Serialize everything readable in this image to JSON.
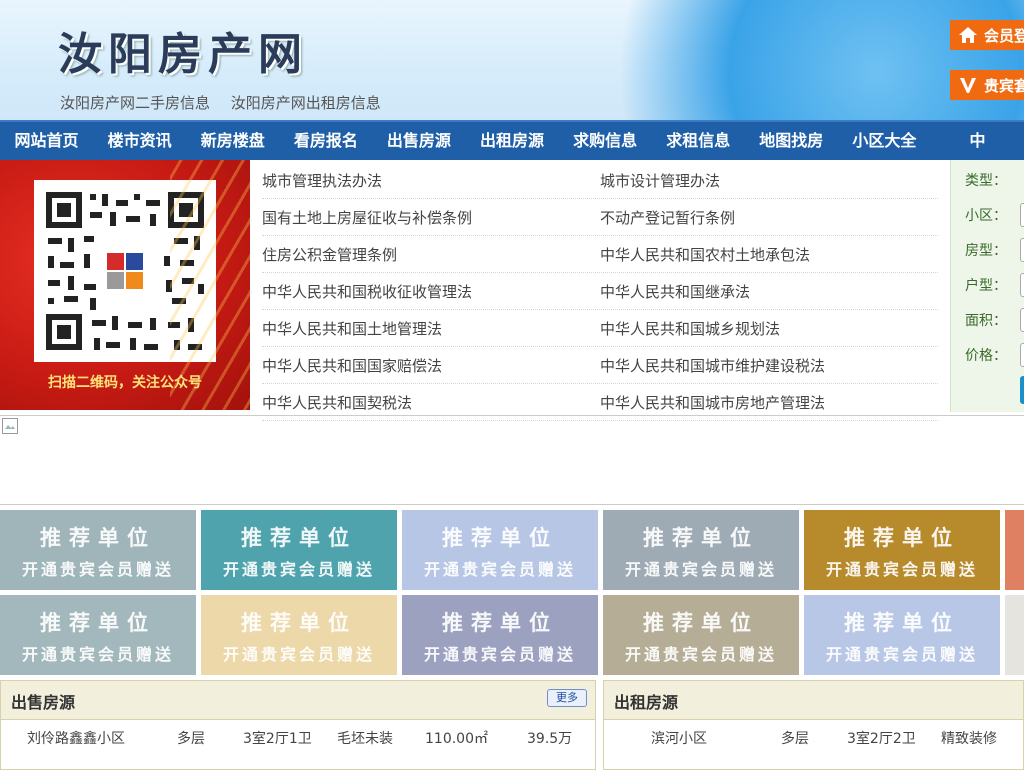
{
  "header": {
    "site_title": "汝阳房产网",
    "sub_links": [
      "汝阳房产网二手房信息",
      "汝阳房产网出租房信息"
    ],
    "member_login": "会员登",
    "vip_label": "贵宾套"
  },
  "nav": {
    "items": [
      "网站首页",
      "楼市资讯",
      "新房楼盘",
      "看房报名",
      "出售房源",
      "出租房源",
      "求购信息",
      "求租信息",
      "地图找房",
      "小区大全",
      "中"
    ]
  },
  "qr_banner": {
    "caption": "扫描二维码，关注公众号"
  },
  "laws": [
    [
      "城市管理执法办法",
      "城市设计管理办法"
    ],
    [
      "国有土地上房屋征收与补偿条例",
      "不动产登记暂行条例"
    ],
    [
      "住房公积金管理条例",
      "中华人民共和国农村土地承包法"
    ],
    [
      "中华人民共和国税收征收管理法",
      "中华人民共和国继承法"
    ],
    [
      "中华人民共和国土地管理法",
      "中华人民共和国城乡规划法"
    ],
    [
      "中华人民共和国国家赔偿法",
      "中华人民共和国城市维护建设税法"
    ],
    [
      "中华人民共和国契税法",
      "中华人民共和国城市房地产管理法"
    ]
  ],
  "search": {
    "labels": [
      "类型：",
      "小区：",
      "房型：",
      "户型：",
      "面积：",
      "价格："
    ]
  },
  "promo": {
    "line1": "推荐单位",
    "line2": "开通贵宾会员赠送",
    "colors_row1": [
      "#9fb5b9",
      "#4fa3ad",
      "#b7c6e4",
      "#9eabb5",
      "#b78a2c",
      "#e08062"
    ],
    "colors_row2": [
      "#a3b8bc",
      "#ecd8a8",
      "#9ca1c0",
      "#b5ad95",
      "#b9c7e6",
      "#e6e4de"
    ]
  },
  "sale_panel": {
    "title": "出售房源",
    "more": "更多",
    "rows": [
      {
        "name": "刘伶路鑫鑫小区",
        "floor": "多层",
        "layout": "3室2厅1卫",
        "decor": "毛坯未装",
        "area": "110.00㎡",
        "price": "39.5万"
      }
    ]
  },
  "rent_panel": {
    "title": "出租房源",
    "rows": [
      {
        "name": "滨河小区",
        "floor": "多层",
        "layout": "3室2厅2卫",
        "decor": "精致装修"
      }
    ]
  }
}
